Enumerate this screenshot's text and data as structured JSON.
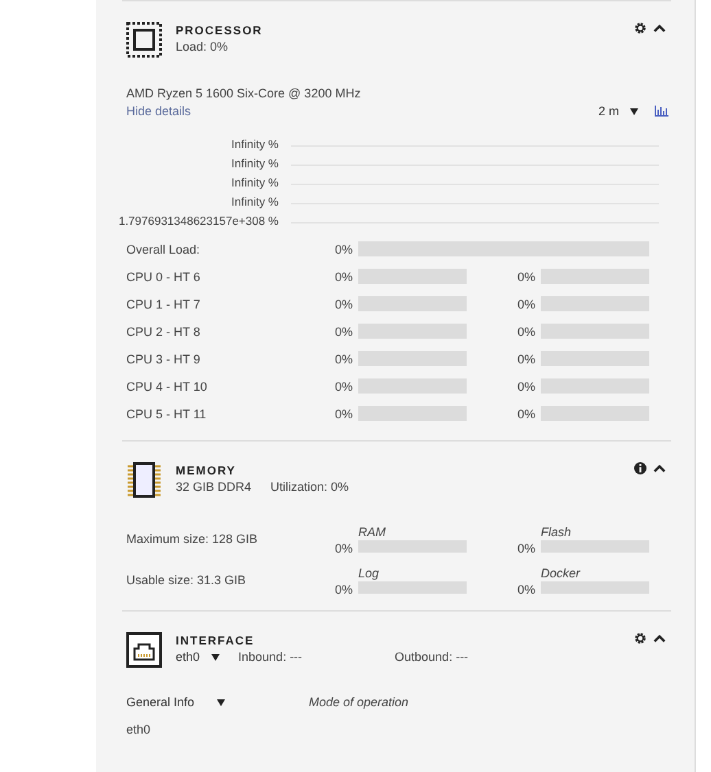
{
  "processor": {
    "title": "PROCESSOR",
    "load": "Load: 0%",
    "model": "AMD Ryzen 5 1600 Six-Core @ 3200 MHz",
    "details_link": "Hide details",
    "range": "2 m",
    "history_rows": [
      "Infinity %",
      "Infinity %",
      "Infinity %",
      "Infinity %",
      "1.7976931348623157e+308 %"
    ],
    "overall": {
      "label": "Overall Load:",
      "reading": "0%",
      "level": 0
    },
    "cpus": [
      {
        "label": "CPU 0 - HT 6",
        "core": {
          "reading": "0%",
          "level": 0
        },
        "thread": {
          "reading": "0%",
          "level": 0
        }
      },
      {
        "label": "CPU 1 - HT 7",
        "core": {
          "reading": "0%",
          "level": 0
        },
        "thread": {
          "reading": "0%",
          "level": 0
        }
      },
      {
        "label": "CPU 2 - HT 8",
        "core": {
          "reading": "0%",
          "level": 0
        },
        "thread": {
          "reading": "0%",
          "level": 0
        }
      },
      {
        "label": "CPU 3 - HT 9",
        "core": {
          "reading": "0%",
          "level": 0
        },
        "thread": {
          "reading": "0%",
          "level": 0
        }
      },
      {
        "label": "CPU 4 - HT 10",
        "core": {
          "reading": "0%",
          "level": 0
        },
        "thread": {
          "reading": "0%",
          "level": 0
        }
      },
      {
        "label": "CPU 5 - HT 11",
        "core": {
          "reading": "0%",
          "level": 0
        },
        "thread": {
          "reading": "0%",
          "level": 0
        }
      }
    ]
  },
  "memory": {
    "title": "MEMORY",
    "type": "32 GIB DDR4",
    "utilization": "Utilization: 0%",
    "rows": [
      {
        "label": "Maximum size: 128 GIB",
        "bars": [
          {
            "name": "RAM",
            "reading": "0%",
            "level": 0
          },
          {
            "name": "Flash",
            "reading": "0%",
            "level": 0
          }
        ]
      },
      {
        "label": "Usable size: 31.3 GIB",
        "bars": [
          {
            "name": "Log",
            "reading": "0%",
            "level": 0
          },
          {
            "name": "Docker",
            "reading": "0%",
            "level": 0
          }
        ]
      }
    ]
  },
  "interface": {
    "title": "INTERFACE",
    "device": "eth0",
    "inbound": "Inbound: ---",
    "outbound": "Outbound: ---",
    "info_select": "General Info",
    "mode_heading": "Mode of operation",
    "value": "eth0"
  }
}
